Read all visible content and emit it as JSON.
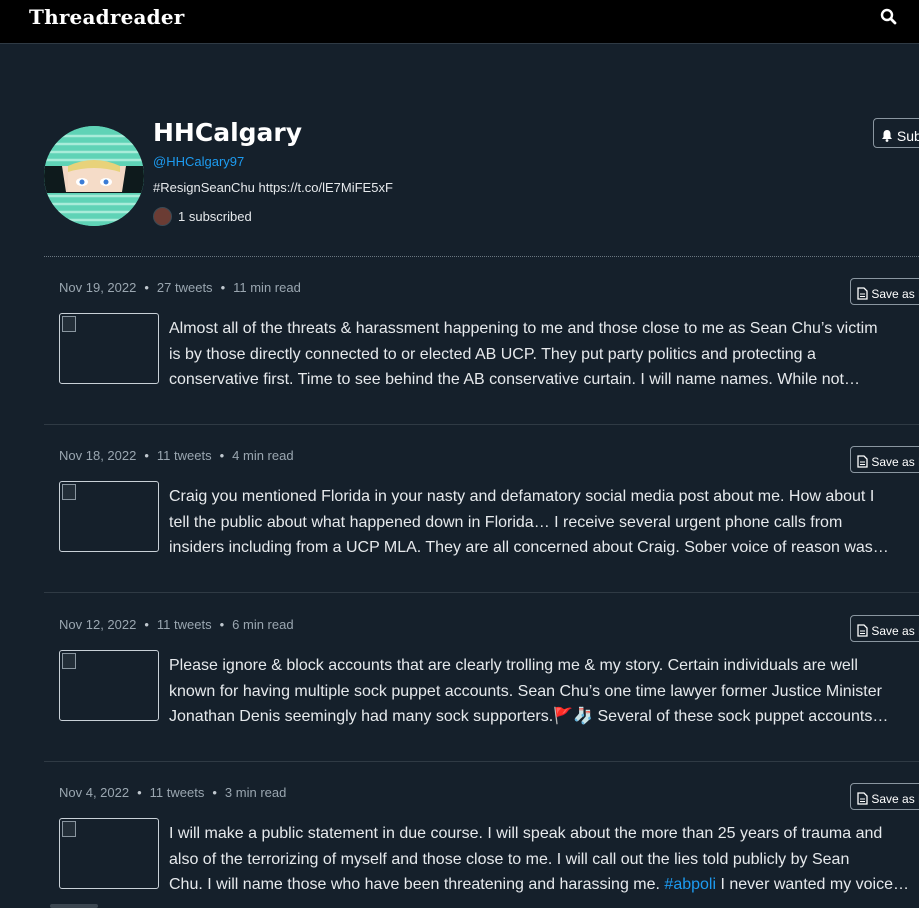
{
  "header": {
    "brand": "Threadreader",
    "search_icon": "search-icon"
  },
  "profile": {
    "name": "HHCalgary",
    "handle": "@HHCalgary97",
    "bio": "#ResignSeanChu https://t.co/lE7MiFE5xF",
    "subscribers": "1 subscribed",
    "subscribe_label": "Subscribe",
    "subscribe_icon": "bell-icon"
  },
  "threads": [
    {
      "date": "Nov 19, 2022",
      "tweets": "27 tweets",
      "read": "11 min read",
      "save_label": "Save as PDF",
      "lines": [
        "Almost all of the threats & harassment happening to me and those close to me as Sean Chu’s victim",
        "is by those directly connected to or elected AB UCP. They put party politics and protecting a",
        "conservative first. Time to see behind the AB conservative curtain. I will name names. While not…"
      ]
    },
    {
      "date": "Nov 18, 2022",
      "tweets": "11 tweets",
      "read": "4 min read",
      "save_label": "Save as PDF",
      "lines": [
        "Craig you mentioned Florida in your nasty and defamatory social media post about me. How about I",
        "tell the public about what happened down in Florida… I receive several urgent phone calls from",
        "insiders including from a UCP MLA. They are all concerned about Craig. Sober voice of reason was…"
      ]
    },
    {
      "date": "Nov 12, 2022",
      "tweets": "11 tweets",
      "read": "6 min read",
      "save_label": "Save as PDF",
      "lines": [
        "Please ignore & block accounts that are clearly trolling me & my story. Certain individuals are well",
        "known for having multiple sock puppet accounts. Sean Chu’s one time lawyer former Justice Minister",
        "Jonathan Denis seemingly had many sock supporters.",
        "🚩",
        "🧦",
        " Several of these sock puppet accounts…"
      ]
    },
    {
      "date": "Nov 4, 2022",
      "tweets": "11 tweets",
      "read": "3 min read",
      "save_label": "Save as PDF",
      "lines": [
        "I will make a public statement in due course. I will speak about the more than 25 years of trauma and",
        "also of the terrorizing of myself and those close to me. I will call out the lies told publicly by Sean",
        "Chu. I will name those who have been threatening and harassing me.",
        "#abpoli",
        " I never wanted my voice…"
      ]
    }
  ],
  "colors": {
    "background": "#15202b",
    "topbar": "#000000",
    "link": "#1d9bf0",
    "muted": "#9aa6b0"
  }
}
